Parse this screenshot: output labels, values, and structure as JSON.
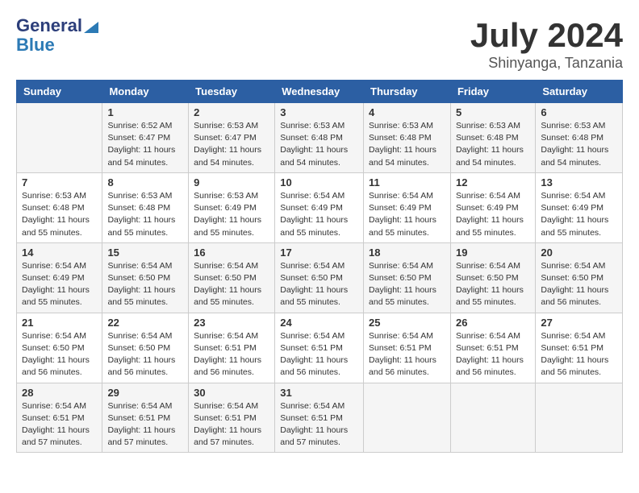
{
  "header": {
    "logo_line1": "General",
    "logo_line2": "Blue",
    "title": "July 2024",
    "location": "Shinyanga, Tanzania"
  },
  "weekdays": [
    "Sunday",
    "Monday",
    "Tuesday",
    "Wednesday",
    "Thursday",
    "Friday",
    "Saturday"
  ],
  "weeks": [
    [
      {
        "day": "",
        "info": ""
      },
      {
        "day": "1",
        "info": "Sunrise: 6:52 AM\nSunset: 6:47 PM\nDaylight: 11 hours\nand 54 minutes."
      },
      {
        "day": "2",
        "info": "Sunrise: 6:53 AM\nSunset: 6:47 PM\nDaylight: 11 hours\nand 54 minutes."
      },
      {
        "day": "3",
        "info": "Sunrise: 6:53 AM\nSunset: 6:48 PM\nDaylight: 11 hours\nand 54 minutes."
      },
      {
        "day": "4",
        "info": "Sunrise: 6:53 AM\nSunset: 6:48 PM\nDaylight: 11 hours\nand 54 minutes."
      },
      {
        "day": "5",
        "info": "Sunrise: 6:53 AM\nSunset: 6:48 PM\nDaylight: 11 hours\nand 54 minutes."
      },
      {
        "day": "6",
        "info": "Sunrise: 6:53 AM\nSunset: 6:48 PM\nDaylight: 11 hours\nand 54 minutes."
      }
    ],
    [
      {
        "day": "7",
        "info": "Sunrise: 6:53 AM\nSunset: 6:48 PM\nDaylight: 11 hours\nand 55 minutes."
      },
      {
        "day": "8",
        "info": "Sunrise: 6:53 AM\nSunset: 6:48 PM\nDaylight: 11 hours\nand 55 minutes."
      },
      {
        "day": "9",
        "info": "Sunrise: 6:53 AM\nSunset: 6:49 PM\nDaylight: 11 hours\nand 55 minutes."
      },
      {
        "day": "10",
        "info": "Sunrise: 6:54 AM\nSunset: 6:49 PM\nDaylight: 11 hours\nand 55 minutes."
      },
      {
        "day": "11",
        "info": "Sunrise: 6:54 AM\nSunset: 6:49 PM\nDaylight: 11 hours\nand 55 minutes."
      },
      {
        "day": "12",
        "info": "Sunrise: 6:54 AM\nSunset: 6:49 PM\nDaylight: 11 hours\nand 55 minutes."
      },
      {
        "day": "13",
        "info": "Sunrise: 6:54 AM\nSunset: 6:49 PM\nDaylight: 11 hours\nand 55 minutes."
      }
    ],
    [
      {
        "day": "14",
        "info": "Sunrise: 6:54 AM\nSunset: 6:49 PM\nDaylight: 11 hours\nand 55 minutes."
      },
      {
        "day": "15",
        "info": "Sunrise: 6:54 AM\nSunset: 6:50 PM\nDaylight: 11 hours\nand 55 minutes."
      },
      {
        "day": "16",
        "info": "Sunrise: 6:54 AM\nSunset: 6:50 PM\nDaylight: 11 hours\nand 55 minutes."
      },
      {
        "day": "17",
        "info": "Sunrise: 6:54 AM\nSunset: 6:50 PM\nDaylight: 11 hours\nand 55 minutes."
      },
      {
        "day": "18",
        "info": "Sunrise: 6:54 AM\nSunset: 6:50 PM\nDaylight: 11 hours\nand 55 minutes."
      },
      {
        "day": "19",
        "info": "Sunrise: 6:54 AM\nSunset: 6:50 PM\nDaylight: 11 hours\nand 55 minutes."
      },
      {
        "day": "20",
        "info": "Sunrise: 6:54 AM\nSunset: 6:50 PM\nDaylight: 11 hours\nand 56 minutes."
      }
    ],
    [
      {
        "day": "21",
        "info": "Sunrise: 6:54 AM\nSunset: 6:50 PM\nDaylight: 11 hours\nand 56 minutes."
      },
      {
        "day": "22",
        "info": "Sunrise: 6:54 AM\nSunset: 6:50 PM\nDaylight: 11 hours\nand 56 minutes."
      },
      {
        "day": "23",
        "info": "Sunrise: 6:54 AM\nSunset: 6:51 PM\nDaylight: 11 hours\nand 56 minutes."
      },
      {
        "day": "24",
        "info": "Sunrise: 6:54 AM\nSunset: 6:51 PM\nDaylight: 11 hours\nand 56 minutes."
      },
      {
        "day": "25",
        "info": "Sunrise: 6:54 AM\nSunset: 6:51 PM\nDaylight: 11 hours\nand 56 minutes."
      },
      {
        "day": "26",
        "info": "Sunrise: 6:54 AM\nSunset: 6:51 PM\nDaylight: 11 hours\nand 56 minutes."
      },
      {
        "day": "27",
        "info": "Sunrise: 6:54 AM\nSunset: 6:51 PM\nDaylight: 11 hours\nand 56 minutes."
      }
    ],
    [
      {
        "day": "28",
        "info": "Sunrise: 6:54 AM\nSunset: 6:51 PM\nDaylight: 11 hours\nand 57 minutes."
      },
      {
        "day": "29",
        "info": "Sunrise: 6:54 AM\nSunset: 6:51 PM\nDaylight: 11 hours\nand 57 minutes."
      },
      {
        "day": "30",
        "info": "Sunrise: 6:54 AM\nSunset: 6:51 PM\nDaylight: 11 hours\nand 57 minutes."
      },
      {
        "day": "31",
        "info": "Sunrise: 6:54 AM\nSunset: 6:51 PM\nDaylight: 11 hours\nand 57 minutes."
      },
      {
        "day": "",
        "info": ""
      },
      {
        "day": "",
        "info": ""
      },
      {
        "day": "",
        "info": ""
      }
    ]
  ]
}
